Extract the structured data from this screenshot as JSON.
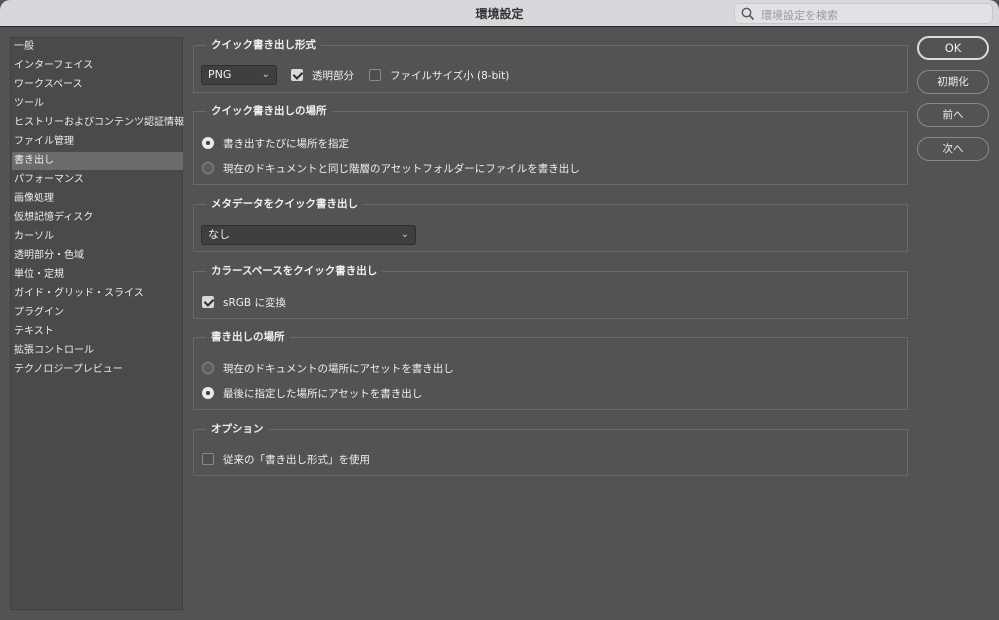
{
  "window": {
    "title": "環境設定"
  },
  "search": {
    "placeholder": "環境設定を検索",
    "icon": "magnifier"
  },
  "sidebar": {
    "items": [
      "一般",
      "インターフェイス",
      "ワークスペース",
      "ツール",
      "ヒストリーおよびコンテンツ認証情報",
      "ファイル管理",
      "書き出し",
      "パフォーマンス",
      "画像処理",
      "仮想記憶ディスク",
      "カーソル",
      "透明部分・色域",
      "単位・定規",
      "ガイド・グリッド・スライス",
      "プラグイン",
      "テキスト",
      "拡張コントロール",
      "テクノロジープレビュー"
    ],
    "selected_index": 6
  },
  "sections": {
    "quick_format": {
      "title": "クイック書き出し形式",
      "format_value": "PNG",
      "transparency_label": "透明部分",
      "transparency_checked": true,
      "small_size_label": "ファイルサイズ小 (8-bit)",
      "small_size_checked": false
    },
    "quick_location": {
      "title": "クイック書き出しの場所",
      "option1": "書き出すたびに場所を指定",
      "option2": "現在のドキュメントと同じ階層のアセットフォルダーにファイルを書き出し",
      "selected": 1
    },
    "metadata": {
      "title": "メタデータをクイック書き出し",
      "value": "なし"
    },
    "color_space": {
      "title": "カラースペースをクイック書き出し",
      "srgb_label": "sRGB に変換",
      "srgb_checked": true
    },
    "export_location": {
      "title": "書き出しの場所",
      "option1": "現在のドキュメントの場所にアセットを書き出し",
      "option2": "最後に指定した場所にアセットを書き出し",
      "selected": 2
    },
    "options": {
      "title": "オプション",
      "legacy_label": "従来の「書き出し形式」を使用",
      "legacy_checked": false
    }
  },
  "buttons": {
    "ok": "OK",
    "reset": "初期化",
    "prev": "前へ",
    "next": "次へ"
  }
}
